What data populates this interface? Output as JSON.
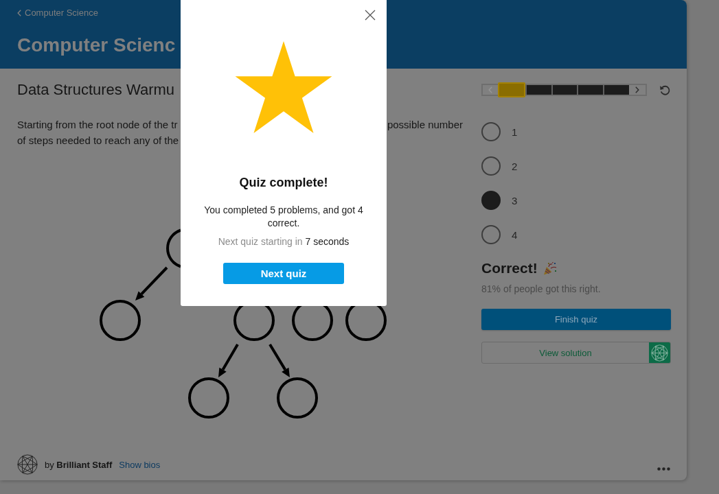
{
  "header": {
    "breadcrumb": "Computer Science",
    "title": "Computer Scienc"
  },
  "problem": {
    "title": "Data Structures Warmu",
    "text_lines": [
      {
        "left": "Starting from the root node of the tr",
        "right": "possible number"
      },
      {
        "left": "of steps needed to reach any of the"
      }
    ]
  },
  "progress": {
    "prev": {
      "disabled": true
    },
    "next": {
      "disabled": false
    },
    "segments": [
      {
        "selected": true
      },
      {
        "selected": false
      },
      {
        "selected": false
      },
      {
        "selected": false
      },
      {
        "selected": false
      }
    ]
  },
  "choices": [
    {
      "label": "1",
      "selected": false
    },
    {
      "label": "2",
      "selected": false
    },
    {
      "label": "3",
      "selected": true
    },
    {
      "label": "4",
      "selected": false
    }
  ],
  "feedback": {
    "title": "Correct!",
    "stat": "81% of people got this right."
  },
  "actions": {
    "finish": "Finish quiz",
    "solution": "View solution"
  },
  "footer": {
    "byline": "by **Brilliant Staff**",
    "link": "Show bios"
  },
  "modal": {
    "title": "Quiz complete!",
    "summary": "You completed 5 problems, and got 4 correct.",
    "countdown_label": "Next quiz starting in",
    "countdown": "7 seconds",
    "button": "Next quiz"
  }
}
